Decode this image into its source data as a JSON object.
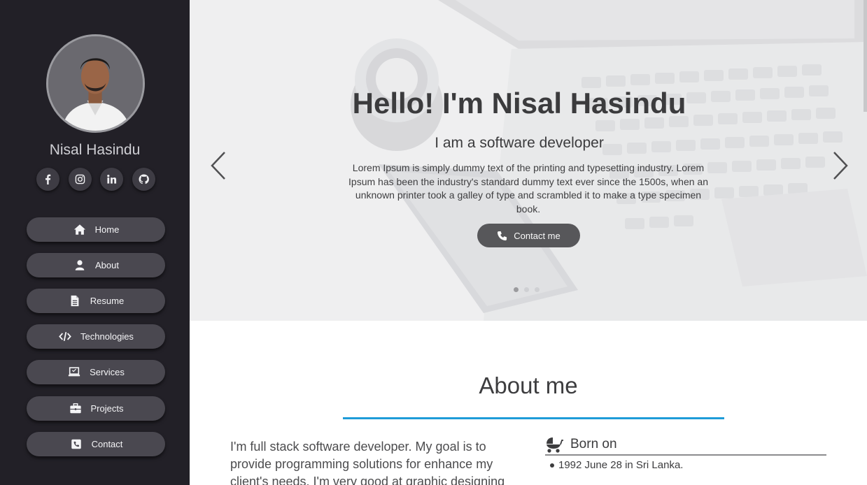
{
  "sidebar": {
    "name": "Nisal Hasindu",
    "socials": [
      {
        "icon": "facebook-icon"
      },
      {
        "icon": "instagram-icon"
      },
      {
        "icon": "linkedin-icon"
      },
      {
        "icon": "github-icon"
      }
    ],
    "nav": [
      {
        "label": "Home",
        "icon": "home-icon"
      },
      {
        "label": "About",
        "icon": "user-icon"
      },
      {
        "label": "Resume",
        "icon": "file-icon"
      },
      {
        "label": "Technologies",
        "icon": "code-icon"
      },
      {
        "label": "Services",
        "icon": "laptop-icon"
      },
      {
        "label": "Projects",
        "icon": "briefcase-icon"
      },
      {
        "label": "Contact",
        "icon": "phone-square-icon"
      }
    ]
  },
  "hero": {
    "title": "Hello! I'm Nisal Hasindu",
    "subtitle": "I am a software developer",
    "text": "Lorem Ipsum is simply dummy text of the printing and typesetting industry. Lorem Ipsum has been the industry's standard dummy text ever since the 1500s, when an unknown printer took a galley of type and scrambled it to make a type specimen book.",
    "cta_label": "Contact me",
    "slide_count": 3,
    "active_slide": 1
  },
  "about": {
    "title": "About me",
    "text": "I'm full stack software developer. My goal is to provide programming solutions for enhance my client's needs. I'm very good at graphic designing",
    "born_label": "Born on",
    "born_value": "1992 June 28 in Sri Lanka."
  },
  "colors": {
    "sidebar_bg": "#222027",
    "nav_button": "#4a4850",
    "accent_line": "#1e9bd8",
    "cta_button": "#57575a"
  }
}
